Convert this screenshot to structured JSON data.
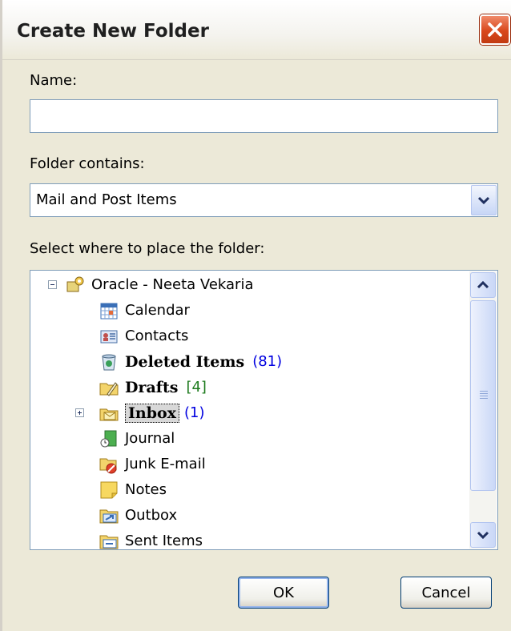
{
  "dialog": {
    "title": "Create New Folder"
  },
  "form": {
    "name_label": "Name:",
    "name_value": "",
    "contains_label": "Folder contains:",
    "contains_value": "Mail and Post Items",
    "place_label": "Select where to place the folder:"
  },
  "tree": {
    "root_label": "Oracle  -  Neeta Vekaria",
    "items": [
      {
        "label": "Calendar",
        "icon": "calendar-icon"
      },
      {
        "label": "Contacts",
        "icon": "contacts-icon"
      },
      {
        "label": "Deleted Items",
        "count": "(81)",
        "icon": "deleted-items-icon"
      },
      {
        "label": "Drafts",
        "count": "[4]",
        "icon": "drafts-icon"
      },
      {
        "label": "Inbox",
        "count": "(1)",
        "icon": "inbox-icon"
      },
      {
        "label": "Journal",
        "icon": "journal-icon"
      },
      {
        "label": "Junk E-mail",
        "icon": "junk-email-icon"
      },
      {
        "label": "Notes",
        "icon": "notes-icon"
      },
      {
        "label": "Outbox",
        "icon": "outbox-icon"
      },
      {
        "label": "Sent Items",
        "icon": "sent-items-icon"
      }
    ]
  },
  "buttons": {
    "ok": "OK",
    "cancel": "Cancel"
  },
  "colors": {
    "count_blue": "#0000e0",
    "count_green": "#1e7b1e",
    "close_red": "#d9481c"
  }
}
